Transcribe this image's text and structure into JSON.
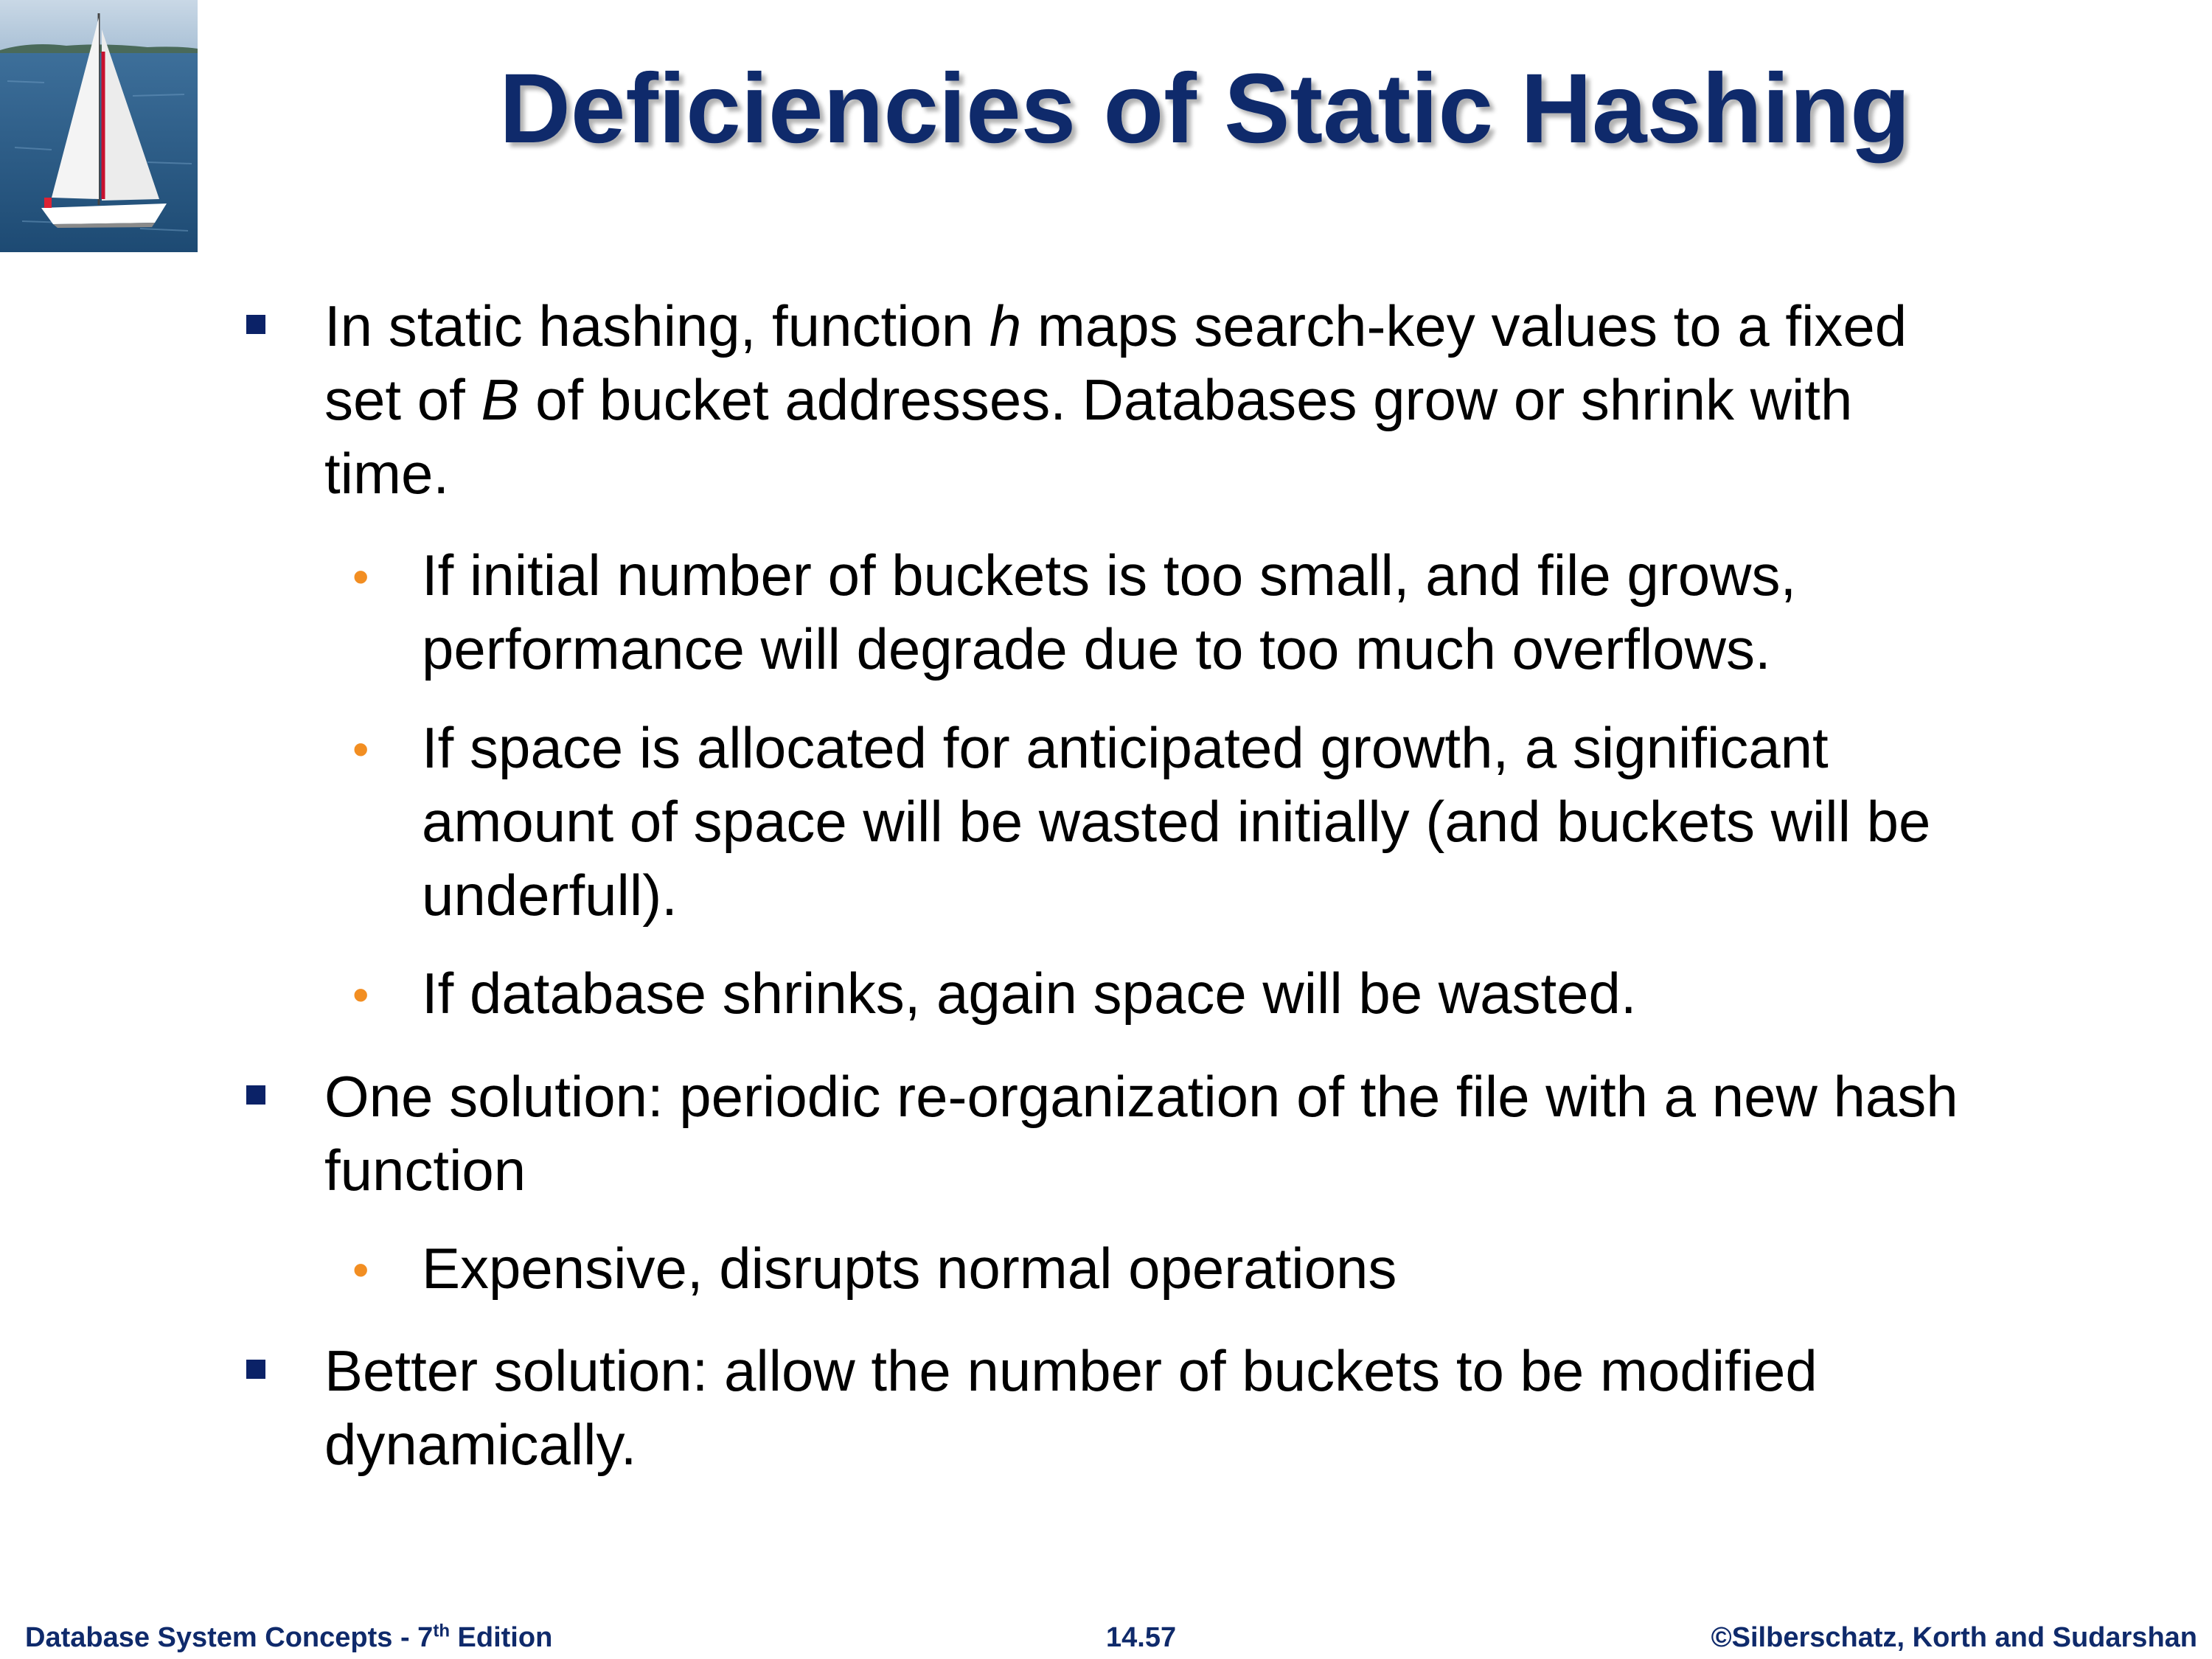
{
  "slide": {
    "title": "Deficiencies of Static Hashing",
    "bullets": [
      {
        "lines": [
          "In static hashing, function ",
          "h",
          " maps search-key values to a fixed",
          "set of ",
          "B",
          " of bucket addresses. Databases grow or shrink with",
          "time."
        ]
      },
      {
        "lines": [
          "If initial number of buckets is too small, and file grows,",
          "performance will degrade due to too much overflows."
        ]
      },
      {
        "lines": [
          "If space is allocated for anticipated growth, a significant",
          "amount of space will be wasted initially (and buckets will be",
          "underfull)."
        ]
      },
      {
        "lines": [
          "If database shrinks, again space will be wasted."
        ]
      },
      {
        "lines": [
          "One solution: periodic re-organization of the file with a new hash",
          "function"
        ]
      },
      {
        "lines": [
          "Expensive, disrupts normal operations"
        ]
      },
      {
        "lines": [
          "Better solution: allow the number of buckets to be modified",
          "dynamically."
        ]
      }
    ]
  },
  "footer": {
    "left_prefix": "Database System Concepts - 7",
    "left_sup": "th",
    "left_suffix": " Edition",
    "center": "14.57",
    "right": "©Silberschatz, Korth and Sudarshan"
  },
  "colors": {
    "title": "#0f2a6b",
    "square_bullet": "#0b2267",
    "round_bullet": "#f28e22"
  },
  "icons": {
    "level1_bullet": "square-bullet-icon",
    "level2_bullet": "round-bullet-icon",
    "corner_image": "sailboat-photo"
  }
}
